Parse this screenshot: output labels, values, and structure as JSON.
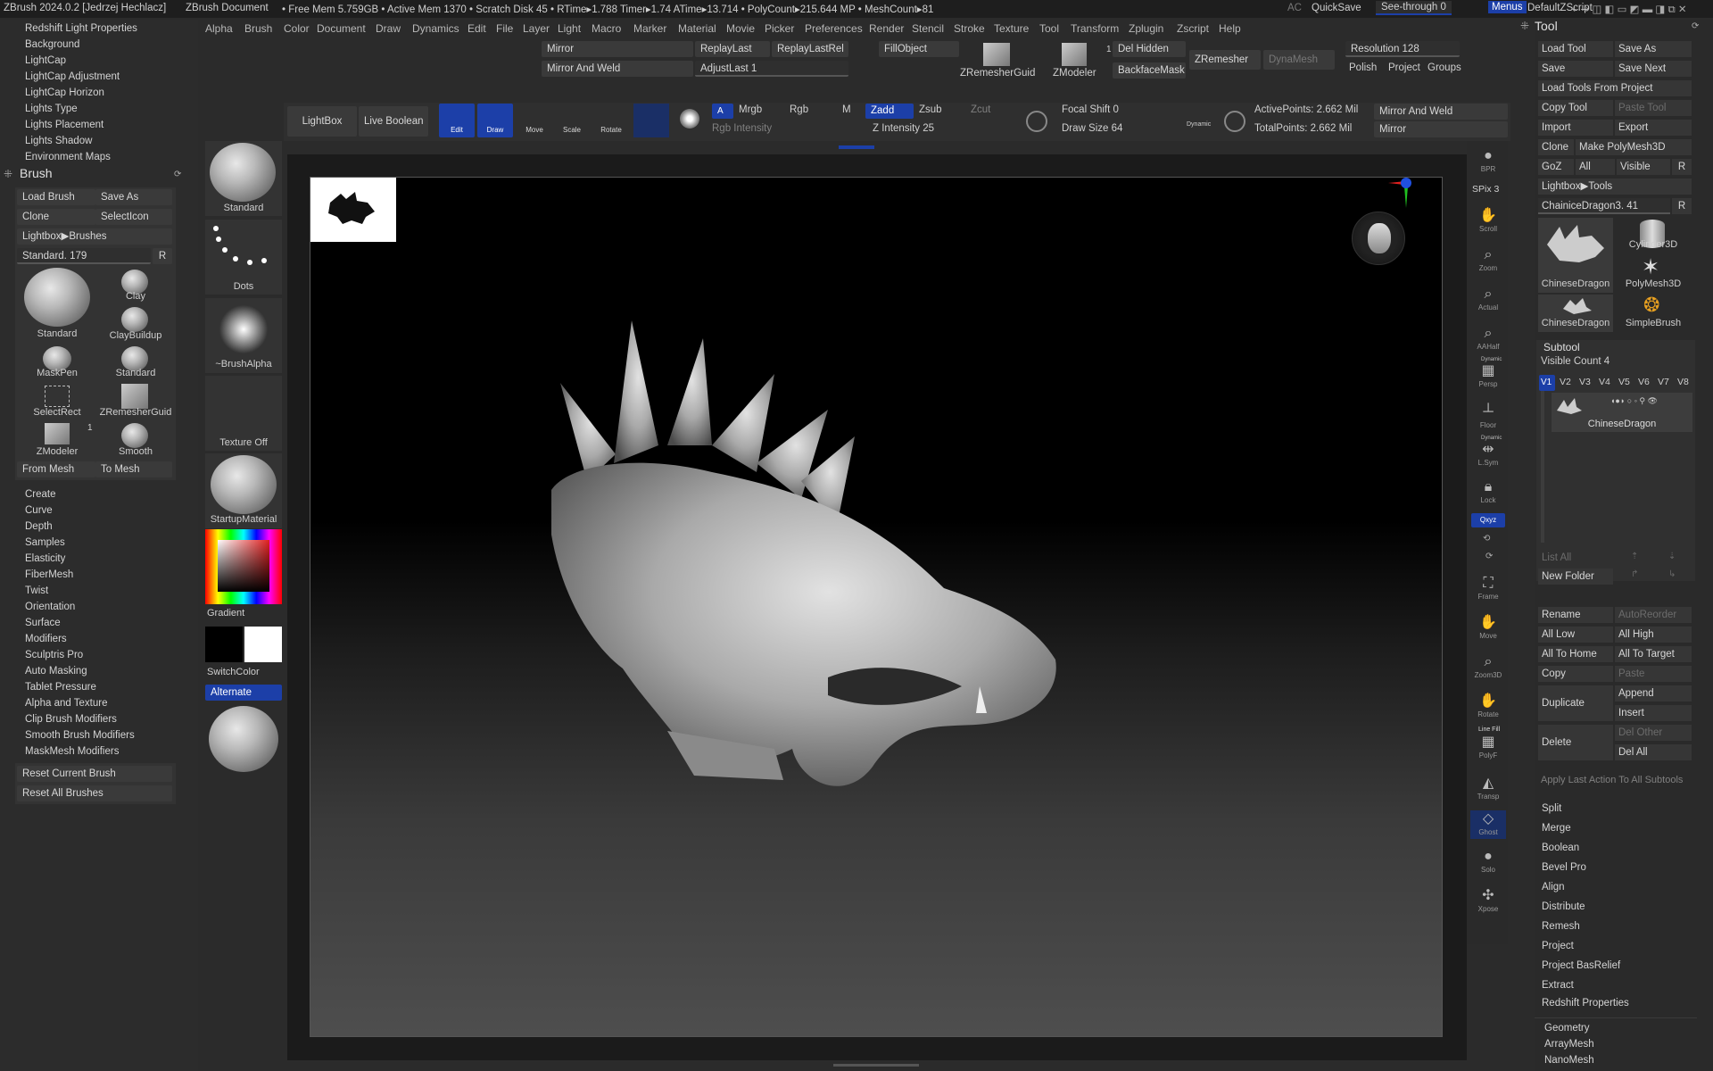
{
  "title_bar": {
    "app": "ZBrush 2024.0.2 [Jedrzej Hechlacz]",
    "document": "ZBrush Document",
    "stats": "• Free Mem 5.759GB • Active Mem 1370 • Scratch Disk 45 •  RTime▸1.788 Timer▸1.74 ATime▸13.714 • PolyCount▸215.644 MP  • MeshCount▸81",
    "ac": "AC",
    "quicksave": "QuickSave",
    "see_through": "See-through  0",
    "menus": "Menus",
    "default_zscript": "DefaultZScript"
  },
  "menu_bar": [
    "Alpha",
    "Brush",
    "Color",
    "Document",
    "Draw",
    "Dynamics",
    "Edit",
    "File",
    "Layer",
    "Light",
    "Macro",
    "Marker",
    "Material",
    "Movie",
    "Picker",
    "Preferences",
    "Render",
    "Stencil",
    "Stroke",
    "Texture",
    "Tool",
    "Transform",
    "Zplugin",
    "Zscript",
    "Help"
  ],
  "top_toolbar": {
    "mirror": "Mirror",
    "mirror_and_weld": "Mirror And Weld",
    "replay_last": "ReplayLast",
    "replay_last_rel": "ReplayLastRel",
    "adjust_last": "AdjustLast 1",
    "fill_object": "FillObject",
    "zremesher_guide": "ZRemesherGuid",
    "zmodeler": "ZModeler",
    "zmodeler_count": "1",
    "del_hidden": "Del Hidden",
    "backface_mask": "BackfaceMask",
    "zremesher": "ZRemesher",
    "dynamesh": "DynaMesh",
    "resolution": "Resolution 128",
    "polish": "Polish",
    "project": "Project",
    "groups": "Groups"
  },
  "draw_toolbar": {
    "lightbox": "LightBox",
    "live_boolean": "Live Boolean",
    "edit": "Edit",
    "draw": "Draw",
    "move": "Move",
    "scale": "Scale",
    "rotate": "Rotate",
    "a": "A",
    "mrgb": "Mrgb",
    "rgb": "Rgb",
    "m": "M",
    "rgb_intensity": "Rgb Intensity",
    "zadd": "Zadd",
    "zsub": "Zsub",
    "zcut": "Zcut",
    "z_intensity": "Z Intensity 25",
    "focal_shift": "Focal Shift 0",
    "draw_size": "Draw Size 64",
    "dynamic": "Dynamic",
    "active_points": "ActivePoints: 2.662 Mil",
    "total_points": "TotalPoints: 2.662 Mil",
    "mirror_and_weld": "Mirror And Weld",
    "mirror": "Mirror"
  },
  "left_panel": {
    "top_items": [
      "Redshift Light Properties",
      "Background",
      "LightCap",
      "LightCap Adjustment",
      "LightCap Horizon",
      "Lights Type",
      "Lights Placement",
      "Lights Shadow",
      "Environment Maps"
    ],
    "brush_header": "Brush",
    "load_brush": "Load Brush",
    "save_as": "Save As",
    "clone": "Clone",
    "select_icon": "SelectIcon",
    "lightbox_brushes": "Lightbox▶Brushes",
    "current_brush": "Standard. 179",
    "r": "R",
    "brushes": [
      "Standard",
      "Clay",
      "ClayBuildup",
      "MaskPen",
      "Standard",
      "SelectRect",
      "ZRemesherGuid",
      "ZModeler",
      "Smooth"
    ],
    "zmodeler_count": "1",
    "from_mesh": "From Mesh",
    "to_mesh": "To Mesh",
    "sub_items": [
      "Create",
      "Curve",
      "Depth",
      "Samples",
      "Elasticity",
      "FiberMesh",
      "Twist",
      "Orientation",
      "Surface",
      "Modifiers",
      "Sculptris Pro",
      "Auto Masking",
      "Tablet Pressure",
      "Alpha and Texture",
      "Clip Brush Modifiers",
      "Smooth Brush Modifiers",
      "MaskMesh Modifiers"
    ],
    "reset_current_brush": "Reset Current Brush",
    "reset_all_brushes": "Reset All Brushes"
  },
  "shelf": {
    "standard": "Standard",
    "dots": "Dots",
    "brush_alpha": "~BrushAlpha",
    "texture_off": "Texture Off",
    "startup_material": "StartupMaterial",
    "gradient": "Gradient",
    "switch_color": "SwitchColor",
    "alternate": "Alternate"
  },
  "right_strip": {
    "spix": "SPix 3",
    "items": [
      "BPR",
      "Scroll",
      "Zoom",
      "Actual",
      "AAHalf",
      "Persp",
      "Floor",
      "L.Sym",
      "Lock",
      "Qxyz",
      "Frame",
      "Move",
      "Zoom3D",
      "Rotate",
      "PolyF",
      "Transp",
      "Ghost",
      "Solo",
      "Xpose"
    ],
    "dynamic": "Dynamic",
    "line_fill": "Line Fill"
  },
  "tool_panel": {
    "header": "Tool",
    "load_tool": "Load Tool",
    "save_as": "Save As",
    "save": "Save",
    "save_next": "Save Next",
    "load_from_project": "Load Tools From Project",
    "copy_tool": "Copy Tool",
    "paste_tool": "Paste Tool",
    "import": "Import",
    "export": "Export",
    "clone": "Clone",
    "make_polymesh": "Make PolyMesh3D",
    "goz": "GoZ",
    "all": "All",
    "visible": "Visible",
    "r": "R",
    "lightbox_tools": "Lightbox▶Tools",
    "current_tool": "ChainiceDragon3. 41",
    "thumbs": [
      "ChineseDragon",
      "Cylinder3D",
      "PolyMesh3D",
      "ChineseDragon",
      "SimpleBrush"
    ],
    "subtool_header": "Subtool",
    "visible_count": "Visible Count 4",
    "v_tabs": [
      "V1",
      "V2",
      "V3",
      "V4",
      "V5",
      "V6",
      "V7",
      "V8"
    ],
    "subtool_name": "ChineseDragon",
    "list_all": "List All",
    "new_folder": "New Folder",
    "rename": "Rename",
    "auto_reorder": "AutoReorder",
    "all_low": "All Low",
    "all_high": "All High",
    "all_to_home": "All To Home",
    "all_to_target": "All To Target",
    "copy": "Copy",
    "paste": "Paste",
    "duplicate": "Duplicate",
    "append": "Append",
    "insert": "Insert",
    "delete": "Delete",
    "del_other": "Del Other",
    "del_all": "Del All",
    "apply_last": "Apply Last Action To All Subtools",
    "sub_items": [
      "Split",
      "Merge",
      "Boolean",
      "Bevel Pro",
      "Align",
      "Distribute",
      "Remesh",
      "Project",
      "Project BasRelief",
      "Extract",
      "Redshift Properties"
    ],
    "bottom_items": [
      "Geometry",
      "ArrayMesh",
      "NanoMesh"
    ]
  },
  "colors": {
    "accent": "#1c3fa8",
    "panel": "#2c2c2c",
    "button": "#3a3a3a"
  }
}
